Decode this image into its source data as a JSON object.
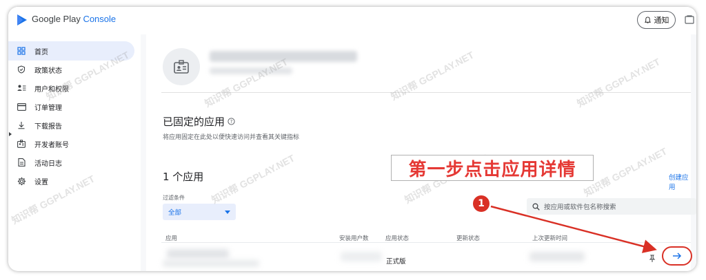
{
  "app": {
    "logo_prefix": "Google Play ",
    "logo_suffix": "Console",
    "notify_label": "通知"
  },
  "sidebar": {
    "items": [
      {
        "label": "首页",
        "icon": "dashboard-icon",
        "active": true
      },
      {
        "label": "政策状态",
        "icon": "shield-icon",
        "active": false
      },
      {
        "label": "用户和权限",
        "icon": "people-icon",
        "active": false
      },
      {
        "label": "订单管理",
        "icon": "card-icon",
        "active": false
      },
      {
        "label": "下载报告",
        "icon": "download-icon",
        "active": false
      },
      {
        "label": "开发者账号",
        "icon": "badge-icon",
        "active": false
      },
      {
        "label": "活动日志",
        "icon": "document-icon",
        "active": false
      },
      {
        "label": "设置",
        "icon": "gear-icon",
        "active": false
      }
    ]
  },
  "main": {
    "pinned_title": "已固定的应用",
    "pinned_subtitle": "将应用固定在此处以便快速访问并查看其关键指标",
    "apps_title": "1 个应用",
    "create_app": "创建应用",
    "filter_label": "过滤条件",
    "filter_value": "全部",
    "search_placeholder": "按应用或软件包名称搜索",
    "table": {
      "headers": [
        "应用",
        "安装用户数",
        "应用状态",
        "更新状态",
        "上次更新时间"
      ],
      "rows": [
        {
          "status": "正式版"
        }
      ]
    }
  },
  "annotation": {
    "text": "第一步点击应用详情",
    "step_number": "1"
  },
  "watermark": {
    "text": "知识帮 GGPLAY.NET"
  },
  "colors": {
    "accent": "#1a73e8",
    "annotation_red": "#d93025",
    "active_bg": "#e8eefc"
  }
}
